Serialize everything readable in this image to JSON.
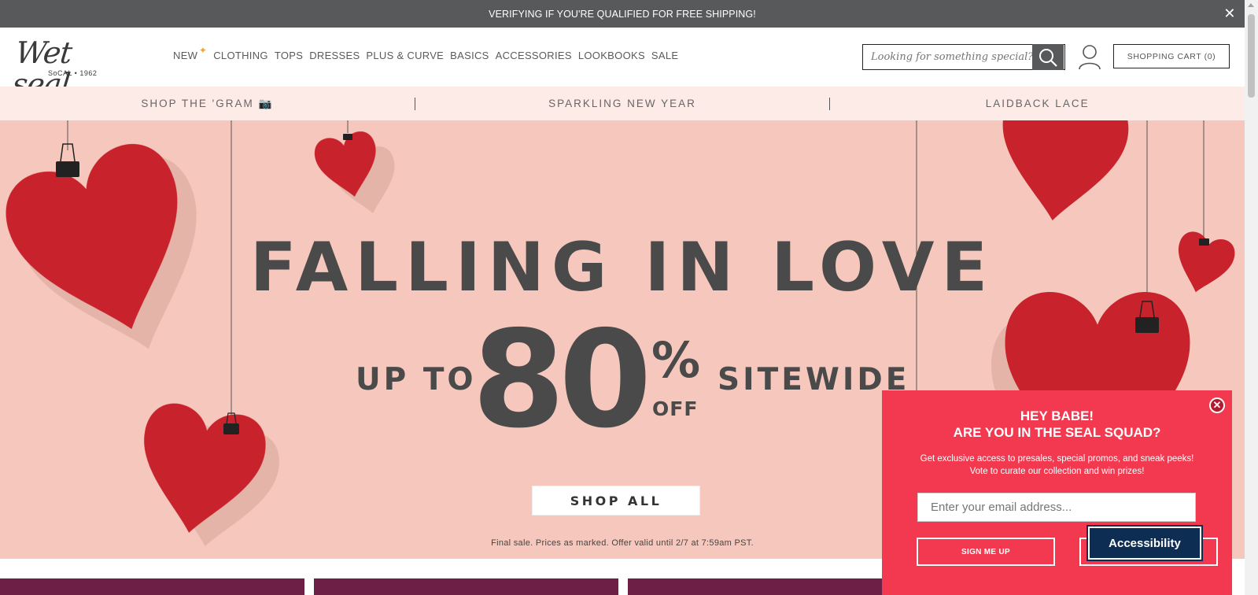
{
  "topbar": {
    "message": "VERIFYING IF YOU'RE QUALIFIED FOR FREE SHIPPING!",
    "close_glyph": "✕"
  },
  "logo": {
    "script": "Wet seal",
    "tagline": "SoCAL • 1962"
  },
  "nav": {
    "items": [
      "NEW",
      "CLOTHING",
      "TOPS",
      "DRESSES",
      "PLUS & CURVE",
      "BASICS",
      "ACCESSORIES",
      "LOOKBOOKS",
      "SALE"
    ],
    "new_star": "✦",
    "new_star_color": "#f5a623"
  },
  "search": {
    "placeholder": "Looking for something special?",
    "icon": "search-icon"
  },
  "account": {
    "icon": "user-icon"
  },
  "cart": {
    "label": "SHOPPING CART (0)"
  },
  "promo_links": [
    "SHOP THE 'GRAM 📷",
    "SPARKLING NEW YEAR",
    "LAIDBACK LACE"
  ],
  "hero": {
    "headline": "FALLING IN LOVE",
    "up_to": "UP TO",
    "number": "80",
    "percent": "%",
    "off": "OFF",
    "sitewide": "SITEWIDE",
    "cta": "SHOP ALL",
    "fine_print": "Final sale. Prices as marked. Offer valid until 2/7 at 7:59am PST.",
    "background_color": "#f6c8bd",
    "heart_color": "#c8232c"
  },
  "popup": {
    "title_line1": "HEY BABE!",
    "title_line2": "ARE YOU IN THE SEAL SQUAD?",
    "body_line1": "Get exclusive access to presales, special promos, and sneak peeks!",
    "body_line2": "Vote to curate our collection and win prizes!",
    "email_placeholder": "Enter your email address...",
    "signup_label": "SIGN ME UP",
    "accessibility_label": "Accessibility",
    "close_glyph": "✕",
    "background_color": "#f2394f"
  },
  "colors": {
    "topbar": "#58595b",
    "subbar": "#fdebe8",
    "strip": "#6e1f45"
  }
}
